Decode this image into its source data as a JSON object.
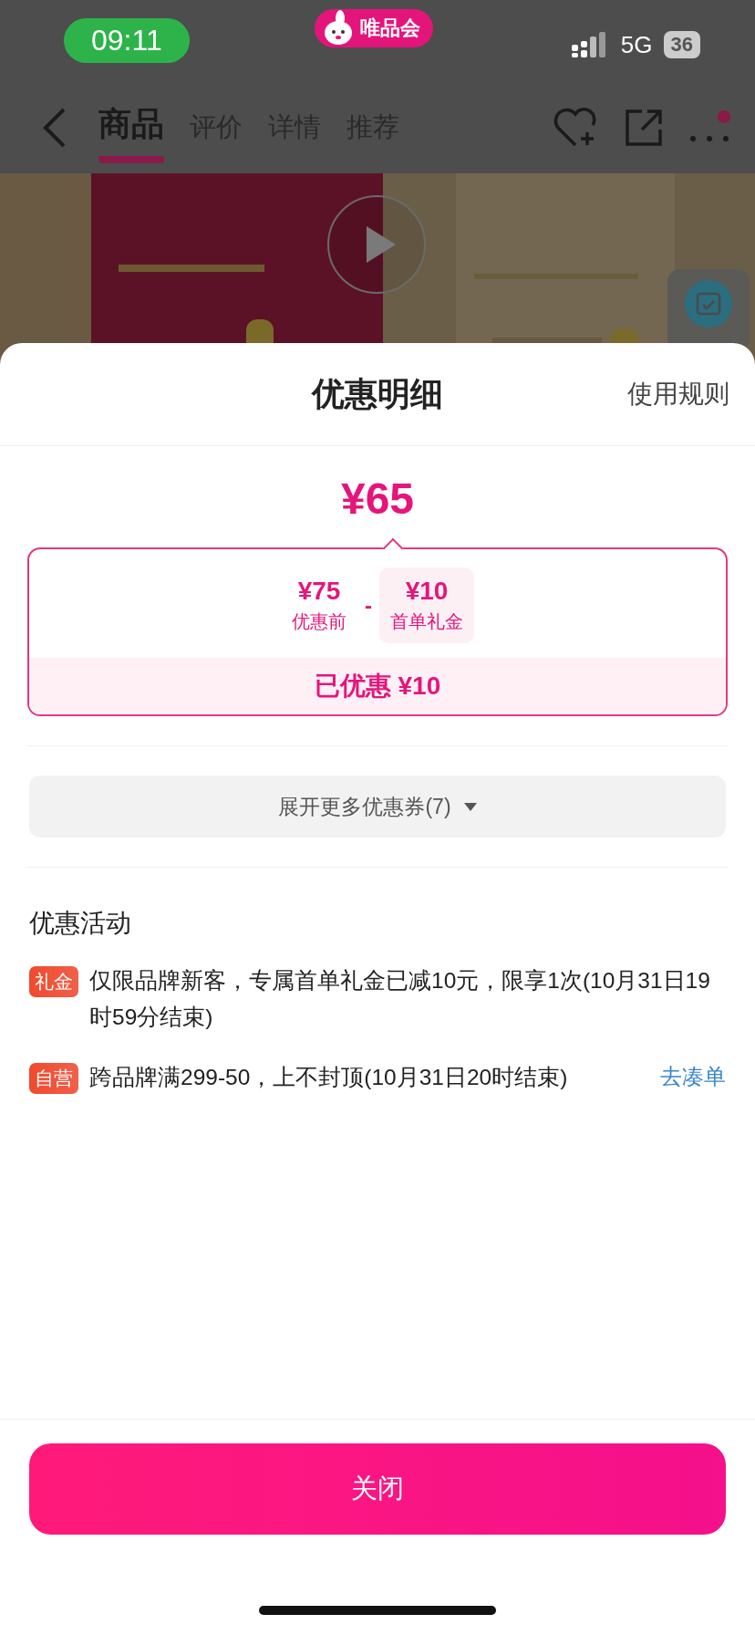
{
  "status_bar": {
    "time": "09:11",
    "app_badge": "唯品会",
    "network": "5G",
    "battery": "36"
  },
  "nav": {
    "tabs": [
      {
        "label": "商品",
        "selected": true
      },
      {
        "label": "评价",
        "selected": false
      },
      {
        "label": "详情",
        "selected": false
      },
      {
        "label": "推荐",
        "selected": false
      }
    ]
  },
  "sheet": {
    "title": "优惠明细",
    "rules_link": "使用规则",
    "final_price": "¥65",
    "breakdown": [
      {
        "amount": "¥75",
        "label": "优惠前",
        "highlighted": false
      },
      {
        "amount": "¥10",
        "label": "首单礼金",
        "highlighted": true
      }
    ],
    "operator": "-",
    "saved": "已优惠 ¥10",
    "expand_button": "展开更多优惠券(7)",
    "section_title": "优惠活动",
    "activities": [
      {
        "tag": "礼金",
        "text": "仅限品牌新客，专属首单礼金已减10元，限享1次(10月31日19时59分结束)"
      },
      {
        "tag": "自营",
        "text": "跨品牌满299-50，上不封顶(10月31日20时结束)",
        "action": "去凑单"
      }
    ],
    "close_button": "关闭"
  }
}
